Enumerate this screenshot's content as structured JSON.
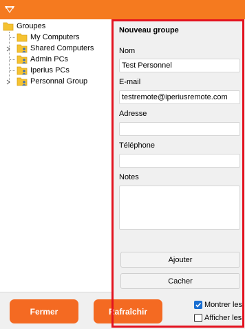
{
  "colors": {
    "accent": "#f57a1f",
    "button": "#f46a22",
    "highlight": "#e3121f",
    "folder": "#f5c231",
    "check": "#1a6fd1"
  },
  "tree": {
    "root_label": "Groupes",
    "items": [
      {
        "label": "My Computers",
        "icon": "folder-icon",
        "expandable": false
      },
      {
        "label": "Shared Computers",
        "icon": "folder-user-icon",
        "expandable": true
      },
      {
        "label": "Admin PCs",
        "icon": "folder-user-icon",
        "expandable": false
      },
      {
        "label": "Iperius PCs",
        "icon": "folder-user-icon",
        "expandable": false
      },
      {
        "label": "Personnal Group",
        "icon": "folder-user-icon",
        "expandable": true
      }
    ]
  },
  "form": {
    "title": "Nouveau groupe",
    "name_label": "Nom",
    "name_value": "Test Personnel",
    "email_label": "E-mail",
    "email_value": "testremote@iperiusremote.com",
    "address_label": "Adresse",
    "address_value": "",
    "phone_label": "Téléphone",
    "phone_value": "",
    "notes_label": "Notes",
    "notes_value": "",
    "add_label": "Ajouter",
    "hide_label": "Cacher"
  },
  "footer": {
    "close_label": "Fermer",
    "refresh_label": "Rafraîchir",
    "show_label": "Montrer les",
    "show_checked": true,
    "display_label": "Afficher les",
    "display_checked": false
  }
}
